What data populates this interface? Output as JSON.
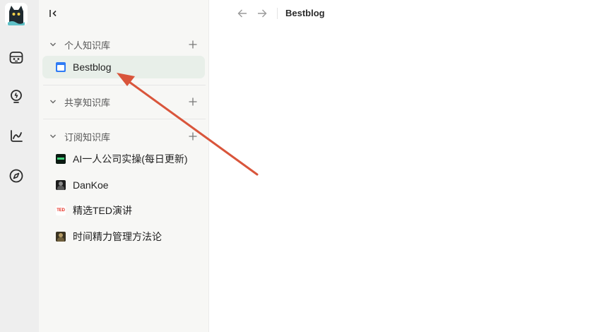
{
  "header": {
    "breadcrumb": "Bestblog"
  },
  "sidebar": {
    "sections": [
      {
        "title": "个人知识库",
        "items": [
          {
            "label": "Bestblog",
            "icon": "calendar-icon",
            "active": true
          }
        ]
      },
      {
        "title": "共享知识库",
        "items": []
      },
      {
        "title": "订阅知识库",
        "items": [
          {
            "label": "AI一人公司实操(每日更新)",
            "icon": "dark-thumbnail-icon"
          },
          {
            "label": "DanKoe",
            "icon": "portrait-thumbnail-icon"
          },
          {
            "label": "精选TED演讲",
            "icon": "ted-logo-icon",
            "icon_text": "TED"
          },
          {
            "label": "时间精力管理方法论",
            "icon": "portrait-thumbnail-icon"
          }
        ]
      }
    ]
  },
  "rail": {
    "items": [
      "cat-avatar",
      "robot-icon",
      "lightbulb-icon",
      "chart-icon",
      "compass-icon"
    ]
  },
  "colors": {
    "accent_active_bg": "#e8efe9",
    "arrow": "#d9553b",
    "calendar_icon": "#2f7bf5",
    "ted_red": "#e62b1e"
  }
}
